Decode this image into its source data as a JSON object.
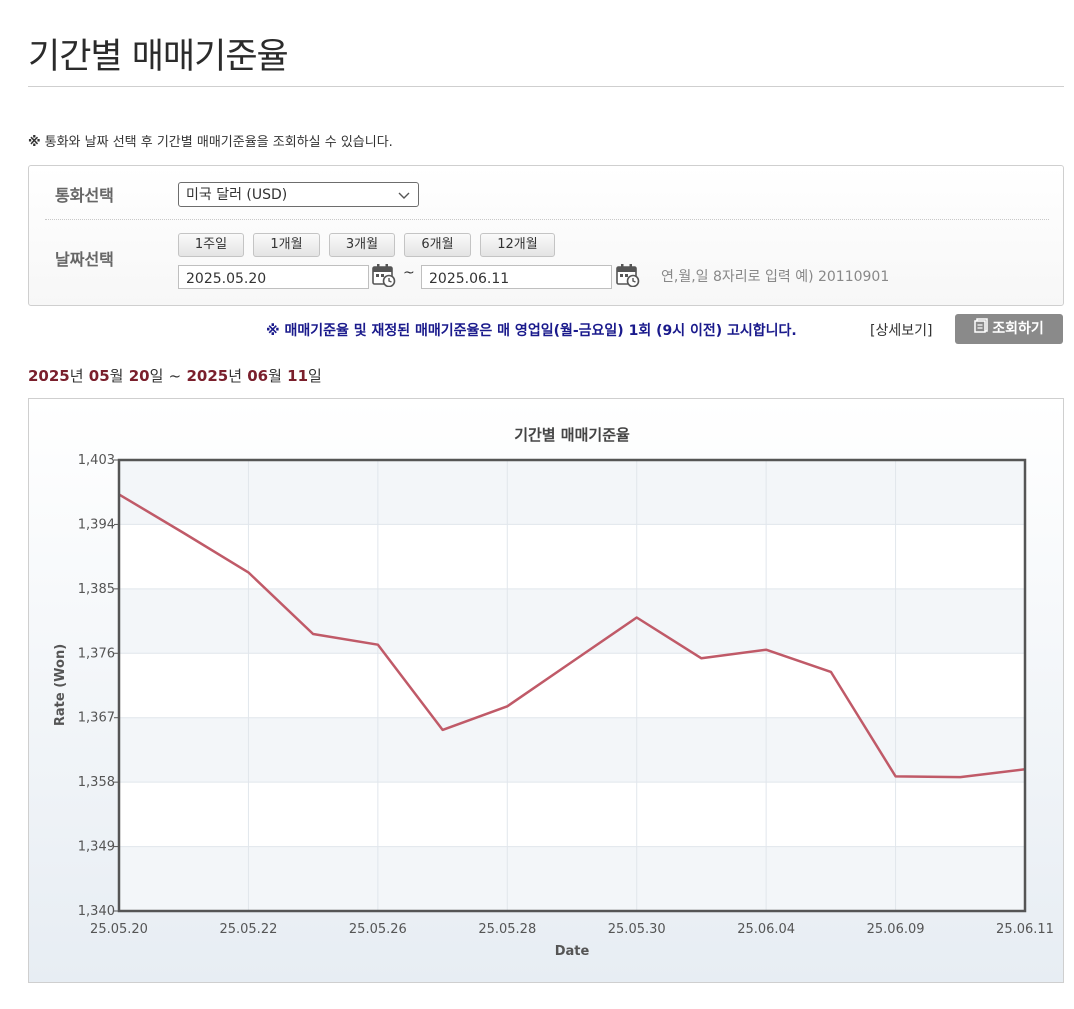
{
  "page": {
    "title": "기간별 매매기준율"
  },
  "notice": {
    "mark": "※",
    "text": "통화와 날짜 선택 후 기간별 매매기준율을 조회하실 수 있습니다."
  },
  "search": {
    "currency_label": "통화선택",
    "currency_value": "미국 달러 (USD)",
    "date_label": "날짜선택",
    "period_buttons": [
      "1주일",
      "1개월",
      "3개월",
      "6개월",
      "12개월"
    ],
    "start_date": "2025.05.20",
    "end_date": "2025.06.11",
    "tilde": "~",
    "date_hint": "연,월,일 8자리로 입력 예) 20110901"
  },
  "notice2": "※ 매매기준율 및 재정된 매매기준율은 매 영업일(월-금요일) 1회 (9시 이전) 고시합니다.",
  "detail_link": "[상세보기]",
  "search_button": "조회하기",
  "range": {
    "y1": "2025",
    "u_year": "년",
    "m1": "05",
    "u_month": "월",
    "d1": "20",
    "u_day": "일",
    "sep": "~",
    "y2": "2025",
    "m2": "06",
    "d2": "11"
  },
  "chart_data": {
    "type": "line",
    "title": "기간별 매매기준율",
    "xlabel": "Date",
    "ylabel": "Rate (Won)",
    "ylim": [
      1340,
      1403
    ],
    "yticks": [
      "1,340",
      "1,349",
      "1,358",
      "1,367",
      "1,376",
      "1,385",
      "1,394",
      "1,403"
    ],
    "xtick_labels": [
      "25.05.20",
      "25.05.22",
      "25.05.26",
      "25.05.28",
      "25.05.30",
      "25.06.04",
      "25.06.09",
      "25.06.11"
    ],
    "x": [
      "25.05.20",
      "25.05.21",
      "25.05.22",
      "25.05.23",
      "25.05.26",
      "25.05.27",
      "25.05.28",
      "25.05.29",
      "25.05.30",
      "25.06.02",
      "25.06.04",
      "25.06.05",
      "25.06.09",
      "25.06.10",
      "25.06.11"
    ],
    "series": [
      {
        "values": [
          1398.2,
          1392.8,
          1387.3,
          1378.7,
          1377.2,
          1365.3,
          1368.6,
          1374.8,
          1381.0,
          1375.3,
          1376.5,
          1373.4,
          1358.8,
          1358.7,
          1359.8
        ]
      }
    ],
    "grid": true,
    "line_color": "#c05a68"
  }
}
